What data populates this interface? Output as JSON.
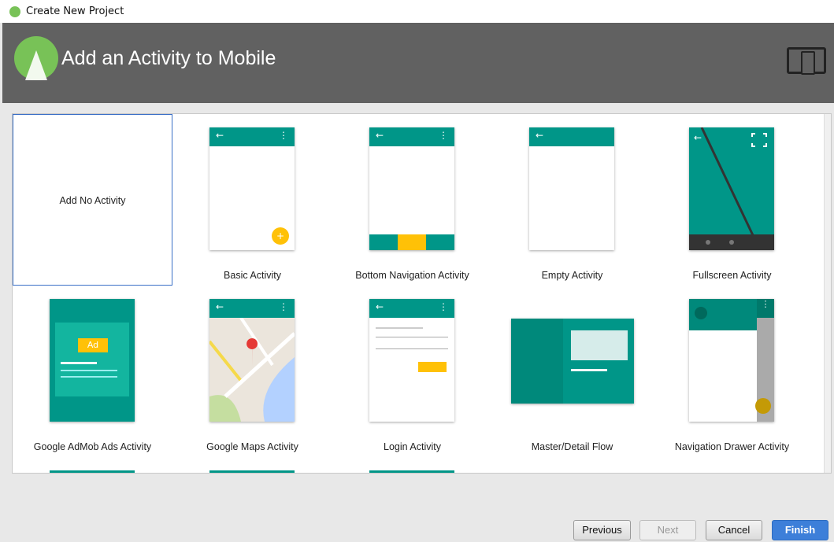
{
  "window": {
    "title": "Create New Project"
  },
  "header": {
    "title": "Add an Activity to Mobile"
  },
  "activities": [
    {
      "label": "Add No Activity"
    },
    {
      "label": "Basic Activity"
    },
    {
      "label": "Bottom Navigation Activity"
    },
    {
      "label": "Empty Activity"
    },
    {
      "label": "Fullscreen Activity"
    },
    {
      "label": "Google AdMob Ads Activity",
      "badge": "Ad"
    },
    {
      "label": "Google Maps Activity"
    },
    {
      "label": "Login Activity"
    },
    {
      "label": "Master/Detail Flow"
    },
    {
      "label": "Navigation Drawer Activity"
    }
  ],
  "buttons": {
    "previous": "Previous",
    "next": "Next",
    "cancel": "Cancel",
    "finish": "Finish"
  },
  "icons": {
    "back": "←",
    "menu": "⋮",
    "fab": "+"
  },
  "colors": {
    "accent": "#009688",
    "fab": "#ffc107",
    "header": "#616161",
    "selected": "#3a6fc6"
  }
}
